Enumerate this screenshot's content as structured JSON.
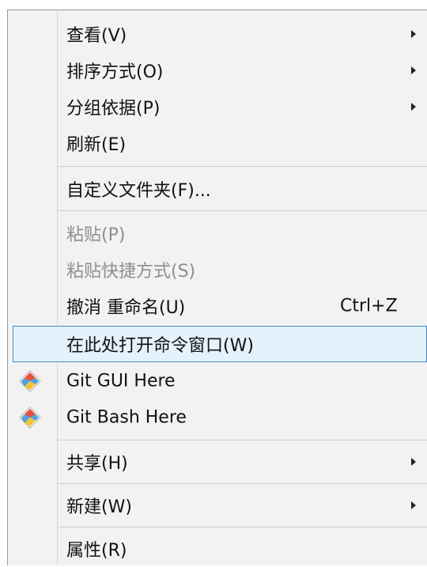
{
  "menu": {
    "items": [
      {
        "label": "查看(V)",
        "submenu": true
      },
      {
        "label": "排序方式(O)",
        "submenu": true
      },
      {
        "label": "分组依据(P)",
        "submenu": true
      },
      {
        "label": "刷新(E)"
      },
      {
        "label": "自定义文件夹(F)..."
      },
      {
        "label": "粘贴(P)",
        "disabled": true
      },
      {
        "label": "粘贴快捷方式(S)",
        "disabled": true
      },
      {
        "label": "撤消 重命名(U)",
        "shortcut": "Ctrl+Z"
      },
      {
        "label": "在此处打开命令窗口(W)",
        "highlighted": true
      },
      {
        "label": "Git GUI Here",
        "icon": "git-icon"
      },
      {
        "label": "Git Bash Here",
        "icon": "git-icon"
      },
      {
        "label": "共享(H)",
        "submenu": true
      },
      {
        "label": "新建(W)",
        "submenu": true
      },
      {
        "label": "属性(R)"
      }
    ]
  },
  "colors": {
    "menu_bg": "#f2f2f2",
    "highlight_bg": "#e5f1fb",
    "highlight_border": "#3f8bd6",
    "disabled_text": "#8e8e8e"
  }
}
